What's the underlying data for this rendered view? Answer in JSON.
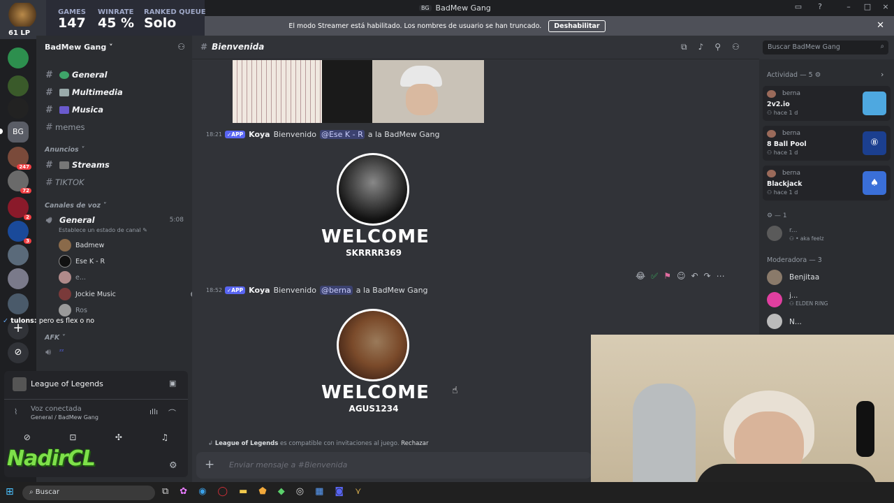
{
  "window": {
    "badge": "BG",
    "title": "BadMew Gang"
  },
  "banner": {
    "text": "El modo Streamer está habilitado. Los nombres de usuario se han truncado.",
    "button": "Deshabilitar"
  },
  "stats": {
    "lp": "61 LP",
    "games_label": "GAMES",
    "games_value": "147",
    "winrate_label": "WINRATE",
    "winrate_value": "45 %",
    "queue_label": "RANKED QUEUE",
    "queue_value": "Solo"
  },
  "rail_badges": [
    "2",
    "247",
    "72",
    "2",
    "3"
  ],
  "sidebar": {
    "server_name": "BadMew Gang",
    "text_channels": [
      {
        "name": "General",
        "bold": true
      },
      {
        "name": "Multimedia",
        "bold": true
      },
      {
        "name": "Musica",
        "bold": true
      },
      {
        "name": "memes",
        "bold": false
      }
    ],
    "cat_announcements": "Anuncios",
    "announce_channels": [
      {
        "name": "Streams",
        "bold": true
      },
      {
        "name": "TIKTOK",
        "bold": false
      }
    ],
    "cat_voice": "Canales de voz",
    "voice_channel": "General",
    "voice_time": "5:08",
    "voice_status": "Establece un estado de canal",
    "voice_users": [
      "Badmew",
      "Ese K - R",
      "e...",
      "Jockie Music",
      "Ros"
    ],
    "cat_afk": "AFK",
    "chat_overlay_user": "tulons:",
    "chat_overlay_text": "pero es flex o no"
  },
  "lol_panel": {
    "game": "League of Legends",
    "voice_connected": "Voz conectada",
    "voice_location": "General / BadMew Gang",
    "streamer_logo": "NadirCL"
  },
  "chat": {
    "channel": "Bienvenida",
    "search_placeholder": "Buscar BadMew Gang",
    "messages": [
      {
        "time": "18:21",
        "app": "APP",
        "author": "Koya",
        "pre": "Bienvenido",
        "mention": "@Ese K - R",
        "post": "a la BadMew Gang",
        "welcome": "WELCOME",
        "user": "SKRRRR369"
      },
      {
        "time": "18:52",
        "app": "APP",
        "author": "Koya",
        "pre": "Bienvenido",
        "mention": "@berna",
        "post": "a la BadMew Gang",
        "welcome": "WELCOME",
        "user": "AGUS1234"
      }
    ],
    "invite_game": "League of Legends",
    "invite_text": "es compatible con invitaciones al juego.",
    "invite_reject": "Rechazar",
    "composer_placeholder": "Enviar mensaje a #Bienvenida"
  },
  "members": {
    "activity_header": "Actividad — 5",
    "activities": [
      {
        "user": "berna",
        "game": "2v2.io",
        "when": "hace 1 d",
        "color": "#4ea8e0"
      },
      {
        "user": "berna",
        "game": "8 Ball Pool",
        "when": "hace 1 d",
        "color": "#1b3f8f"
      },
      {
        "user": "berna",
        "game": "Blackjack",
        "when": "hace 1 d",
        "color": "#3a6fd8"
      }
    ],
    "group1_header": "— 1",
    "group1_user": "r...",
    "group1_status": "• aka feelz",
    "mod_header": "Moderadora — 3",
    "mods": [
      {
        "name": "Benjitaa",
        "status": ""
      },
      {
        "name": "j...",
        "status": "ELDEN RING"
      },
      {
        "name": "N...",
        "status": ""
      }
    ]
  },
  "taskbar": {
    "search": "Buscar"
  },
  "colors": {
    "accent": "#5865f2",
    "background": "#313338",
    "sidebar": "#2b2d31",
    "rail": "#1e1f22"
  }
}
